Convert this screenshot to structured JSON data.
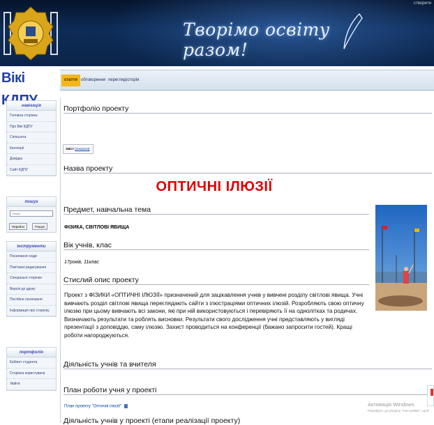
{
  "header": {
    "slogan": "Творімо освіту разом!",
    "user_text": "створити",
    "site_title": "Вікі КДПУ"
  },
  "tabs": [
    {
      "label": "стаття",
      "active": true
    },
    {
      "label": "обговорення",
      "active": false
    },
    {
      "label": "перегляд",
      "active": false
    },
    {
      "label": "історія",
      "active": false
    }
  ],
  "sidebar": {
    "navigation": {
      "title": "навігація",
      "items": [
        "Головна сторінка",
        "Про Вікі КДПУ",
        "Спільнота",
        "Категорії",
        "Довідка",
        "Сайт КДПУ"
      ]
    },
    "search": {
      "title": "пошук",
      "placeholder": "Пошук",
      "go_label": "Перейти",
      "search_label": "Пошук"
    },
    "tools": {
      "title": "інструменти",
      "items": [
        "Посилання сюди",
        "Пов'язані редагування",
        "Спеціальні сторінки",
        "Версія до друку",
        "Постійне посилання",
        "Інформація про сторінку"
      ]
    },
    "portfolio": {
      "title": "портфоліо",
      "items": [
        "Кабінет студента",
        "Сторінка користувача",
        "Увійти"
      ]
    }
  },
  "content": {
    "page_heading": "Портфоліо проекту",
    "toc": {
      "label": "Зміст",
      "link": "[показати]"
    },
    "project_name_heading": "Назва проекту",
    "project_title": "ОПТИЧНІ ІЛЮЗІЇ",
    "subject_heading": "Предмет, навчальна тема",
    "subject_value": "ФІЗИКА, СВІТЛОВІ ЯВИЩА",
    "age_heading": "Вік учнів, клас",
    "age_value": "17років, 11клас",
    "summary_heading": "Стислий опис проекту",
    "summary_text": "Проект з ФІЗИКИ «ОПТИЧНІ ІЛЮЗІЇ» призначений для зацікавлення учнів у вивчені розділу світлові явища. Учні вивчають розділ світлові явища переглядають сайти з ілюстраціями оптичних ілюзій. Розробляють свою оптичну ілюзію при цьому вивчають всі закони, які при ній використовуються і перевіряють її на однолітках та родичах. Визначають результати та роблять висновки. Результати свого дослідження учні представляють у вигляді презентації з доповіддю, саму ілюзію. Захист проводиться на конференції (бажано запросити гостей). Кращі роботи нагороджуються.",
    "activity_heading": "Діяльність учнів та вчителя",
    "plan_heading": "План роботи учня у проекті",
    "plan_link": "План проекту \"Оптичні ілюзії\"",
    "stages_heading": "Діяльність учнів у проекті (етапи реалізації проекту)"
  },
  "watermark": {
    "title": "Активація Windows",
    "subtitle": "Перейдіть до розділу \"Настройки\", щоб"
  },
  "colors": {
    "header_bg": "#0b2448",
    "active_tab": "#f5b80f",
    "project_title": "#e00000",
    "link": "#0645ad",
    "portlet_title": "#3b4db0"
  }
}
